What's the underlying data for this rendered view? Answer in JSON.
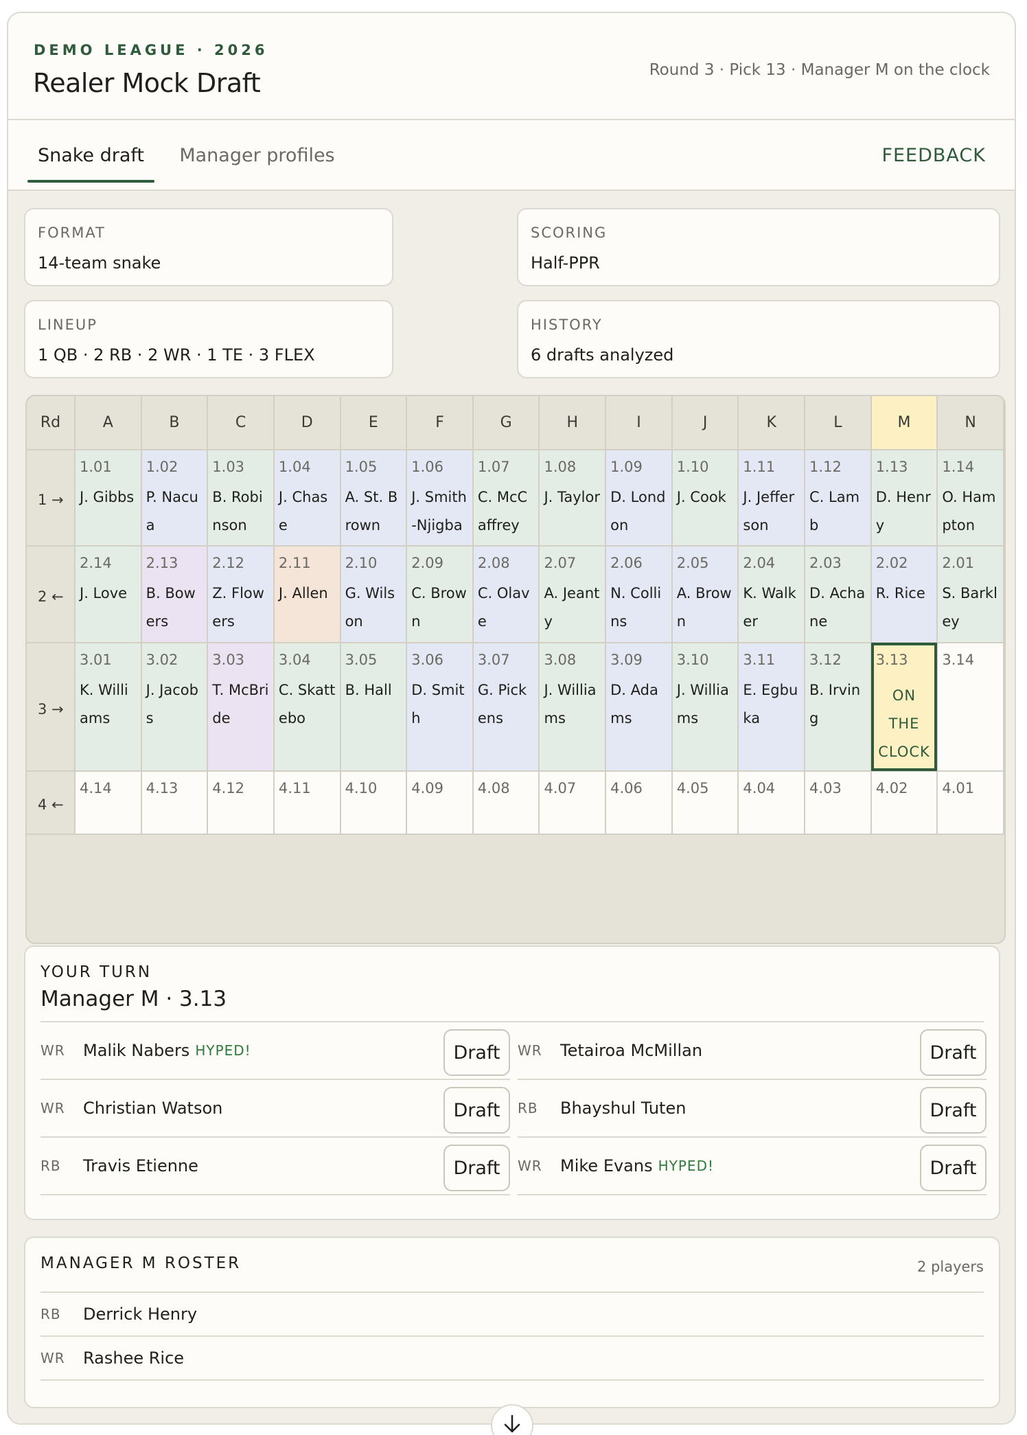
{
  "header": {
    "eyebrow": "DEMO LEAGUE · 2026",
    "title": "Realer Mock Draft",
    "status": "Round 3 · Pick 13 · Manager M on the clock"
  },
  "tabs": {
    "snake_draft": "Snake draft",
    "manager_profiles": "Manager profiles",
    "feedback": "FEEDBACK"
  },
  "info": {
    "format": {
      "label": "FORMAT",
      "value": "14-team snake"
    },
    "scoring": {
      "label": "SCORING",
      "value": "Half-PPR"
    },
    "lineup": {
      "label": "LINEUP",
      "value": "1 QB · 2 RB · 2 WR · 1 TE · 3 FLEX"
    },
    "history": {
      "label": "HISTORY",
      "value": "6 drafts analyzed"
    }
  },
  "board": {
    "rd_header": "Rd",
    "columns": [
      "A",
      "B",
      "C",
      "D",
      "E",
      "F",
      "G",
      "H",
      "I",
      "J",
      "K",
      "L",
      "M",
      "N"
    ],
    "highlight_column": "M",
    "position_colors": {
      "WR": "#e4e8f4",
      "RB": "#e3ede6",
      "TE": "#ece3f2",
      "QB": "#f5e5d8",
      "empty": "#fdfcf8",
      "clock": "#fdf1c4"
    },
    "rounds": [
      {
        "label": "1 →",
        "cells": [
          {
            "pick": "1.01",
            "name": "J. Gibbs",
            "pos": "RB"
          },
          {
            "pick": "1.02",
            "name": "P. Nacua",
            "pos": "WR"
          },
          {
            "pick": "1.03",
            "name": "B. Robinson",
            "pos": "RB"
          },
          {
            "pick": "1.04",
            "name": "J. Chase",
            "pos": "WR"
          },
          {
            "pick": "1.05",
            "name": "A. St. Brown",
            "pos": "WR"
          },
          {
            "pick": "1.06",
            "name": "J. Smith-Njigba",
            "pos": "WR"
          },
          {
            "pick": "1.07",
            "name": "C. McCaffrey",
            "pos": "RB"
          },
          {
            "pick": "1.08",
            "name": "J. Taylor",
            "pos": "RB"
          },
          {
            "pick": "1.09",
            "name": "D. London",
            "pos": "WR"
          },
          {
            "pick": "1.10",
            "name": "J. Cook",
            "pos": "RB"
          },
          {
            "pick": "1.11",
            "name": "J. Jefferson",
            "pos": "WR"
          },
          {
            "pick": "1.12",
            "name": "C. Lamb",
            "pos": "WR"
          },
          {
            "pick": "1.13",
            "name": "D. Henry",
            "pos": "RB"
          },
          {
            "pick": "1.14",
            "name": "O. Hampton",
            "pos": "RB"
          }
        ]
      },
      {
        "label": "2 ←",
        "cells": [
          {
            "pick": "2.14",
            "name": "J. Love",
            "pos": "RB"
          },
          {
            "pick": "2.13",
            "name": "B. Bowers",
            "pos": "TE"
          },
          {
            "pick": "2.12",
            "name": "Z. Flowers",
            "pos": "WR"
          },
          {
            "pick": "2.11",
            "name": "J. Allen",
            "pos": "QB"
          },
          {
            "pick": "2.10",
            "name": "G. Wilson",
            "pos": "WR"
          },
          {
            "pick": "2.09",
            "name": "C. Brown",
            "pos": "RB"
          },
          {
            "pick": "2.08",
            "name": "C. Olave",
            "pos": "WR"
          },
          {
            "pick": "2.07",
            "name": "A. Jeanty",
            "pos": "RB"
          },
          {
            "pick": "2.06",
            "name": "N. Collins",
            "pos": "WR"
          },
          {
            "pick": "2.05",
            "name": "A. Brown",
            "pos": "WR"
          },
          {
            "pick": "2.04",
            "name": "K. Walker",
            "pos": "RB"
          },
          {
            "pick": "2.03",
            "name": "D. Achane",
            "pos": "RB"
          },
          {
            "pick": "2.02",
            "name": "R. Rice",
            "pos": "WR"
          },
          {
            "pick": "2.01",
            "name": "S. Barkley",
            "pos": "RB"
          }
        ]
      },
      {
        "label": "3 →",
        "cells": [
          {
            "pick": "3.01",
            "name": "K. Williams",
            "pos": "RB"
          },
          {
            "pick": "3.02",
            "name": "J. Jacobs",
            "pos": "RB"
          },
          {
            "pick": "3.03",
            "name": "T. McBride",
            "pos": "TE"
          },
          {
            "pick": "3.04",
            "name": "C. Skattebo",
            "pos": "RB"
          },
          {
            "pick": "3.05",
            "name": "B. Hall",
            "pos": "RB"
          },
          {
            "pick": "3.06",
            "name": "D. Smith",
            "pos": "WR"
          },
          {
            "pick": "3.07",
            "name": "G. Pickens",
            "pos": "WR"
          },
          {
            "pick": "3.08",
            "name": "J. Williams",
            "pos": "RB"
          },
          {
            "pick": "3.09",
            "name": "D. Adams",
            "pos": "WR"
          },
          {
            "pick": "3.10",
            "name": "J. Williams",
            "pos": "RB"
          },
          {
            "pick": "3.11",
            "name": "E. Egbuka",
            "pos": "WR"
          },
          {
            "pick": "3.12",
            "name": "B. Irving",
            "pos": "RB"
          },
          {
            "pick": "3.13",
            "name": "ON THE CLOCK",
            "pos": "clock"
          },
          {
            "pick": "3.14",
            "name": "",
            "pos": "empty"
          }
        ]
      },
      {
        "label": "4 ←",
        "cells": [
          {
            "pick": "4.14",
            "name": "",
            "pos": "empty"
          },
          {
            "pick": "4.13",
            "name": "",
            "pos": "empty"
          },
          {
            "pick": "4.12",
            "name": "",
            "pos": "empty"
          },
          {
            "pick": "4.11",
            "name": "",
            "pos": "empty"
          },
          {
            "pick": "4.10",
            "name": "",
            "pos": "empty"
          },
          {
            "pick": "4.09",
            "name": "",
            "pos": "empty"
          },
          {
            "pick": "4.08",
            "name": "",
            "pos": "empty"
          },
          {
            "pick": "4.07",
            "name": "",
            "pos": "empty"
          },
          {
            "pick": "4.06",
            "name": "",
            "pos": "empty"
          },
          {
            "pick": "4.05",
            "name": "",
            "pos": "empty"
          },
          {
            "pick": "4.04",
            "name": "",
            "pos": "empty"
          },
          {
            "pick": "4.03",
            "name": "",
            "pos": "empty"
          },
          {
            "pick": "4.02",
            "name": "",
            "pos": "empty"
          },
          {
            "pick": "4.01",
            "name": "",
            "pos": "empty"
          }
        ]
      }
    ]
  },
  "your_turn": {
    "eyebrow": "YOUR TURN",
    "title": "Manager M · 3.13",
    "draft_label": "Draft",
    "hyped_label": "HYPED!",
    "players": [
      {
        "pos": "WR",
        "name": "Malik Nabers",
        "hyped": true
      },
      {
        "pos": "WR",
        "name": "Tetairoa McMillan",
        "hyped": false
      },
      {
        "pos": "WR",
        "name": "Christian Watson",
        "hyped": false
      },
      {
        "pos": "RB",
        "name": "Bhayshul Tuten",
        "hyped": false
      },
      {
        "pos": "RB",
        "name": "Travis Etienne",
        "hyped": false
      },
      {
        "pos": "WR",
        "name": "Mike Evans",
        "hyped": true
      }
    ]
  },
  "roster": {
    "title": "MANAGER M ROSTER",
    "count": "2 players",
    "players": [
      {
        "pos": "RB",
        "name": "Derrick Henry"
      },
      {
        "pos": "WR",
        "name": "Rashee Rice"
      }
    ]
  },
  "scroll_button_icon": "arrow-down-icon"
}
